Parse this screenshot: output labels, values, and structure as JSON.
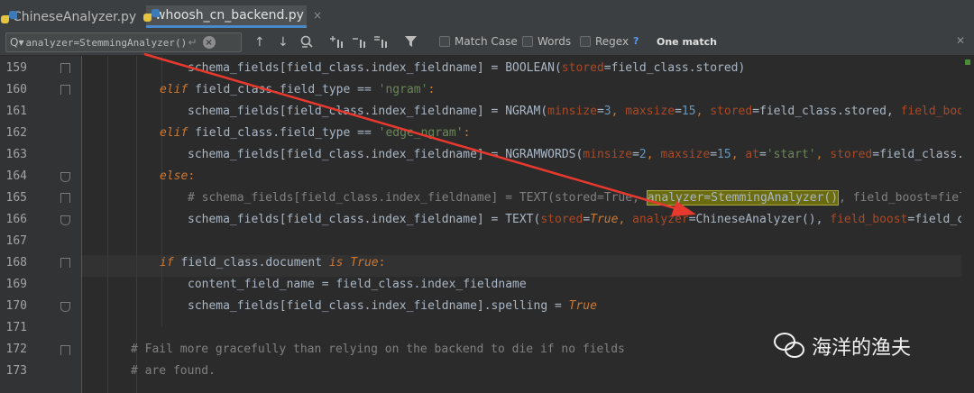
{
  "tabs": [
    {
      "label": "ChineseAnalyzer.py",
      "close": "×",
      "active": false
    },
    {
      "label": "whoosh_cn_backend.py",
      "close": "×",
      "active": true
    }
  ],
  "find": {
    "search_icon": "search-icon",
    "query": "analyzer=StemmingAnalyzer()",
    "return_glyph": "↵",
    "clear_glyph": "×",
    "prev_glyph": "↑",
    "next_glyph": "↓",
    "match_case": "Match Case",
    "words": "Words",
    "regex": "Regex",
    "help": "?",
    "status": "One match",
    "close_glyph": "✕"
  },
  "line_numbers": [
    "159",
    "160",
    "161",
    "162",
    "163",
    "164",
    "165",
    "166",
    "167",
    "168",
    "169",
    "170",
    "171",
    "172",
    "173"
  ],
  "watermark": {
    "text": "海洋的渔夫"
  },
  "colors": {
    "keyword": "#cc7832",
    "string": "#6a8759",
    "number": "#6897bb",
    "comment": "#808080",
    "param": "#aa4926",
    "highlight": "#6b6b10",
    "arrow": "#e8392e"
  },
  "code": {
    "l159": {
      "a": "schema_fields[field_class.index_fieldname] = BOOLEAN(",
      "b": "stored",
      "c": "=field_class.stored)"
    },
    "l160": {
      "a": "elif",
      "b": " field_class.field_type == ",
      "c": "'ngram'",
      "d": ":"
    },
    "l161": {
      "a": "schema_fields[field_class.index_fieldname] = NGRAM(",
      "b": "minsize",
      "c": "=",
      "d": "3",
      "e": ", ",
      "f": "maxsize",
      "g": "=",
      "h": "15",
      "i": ", ",
      "j": "stored",
      "k": "=field_class.stored, ",
      "l": "field_boost"
    },
    "l162": {
      "a": "elif",
      "b": " field_class.field_type == ",
      "c": "'edge_ngram'",
      "d": ":"
    },
    "l163": {
      "a": "schema_fields[field_class.index_fieldname] = NGRAMWORDS(",
      "b": "minsize",
      "c": "=",
      "d": "2",
      "e": ", ",
      "f": "maxsize",
      "g": "=",
      "h": "15",
      "i": ", ",
      "j": "at",
      "k": "=",
      "l": "'start'",
      "m": ", ",
      "n": "stored",
      "o": "=field_class.s"
    },
    "l164": {
      "a": "else",
      "b": ":"
    },
    "l165": {
      "a": "# schema_fields[field_class.index_fieldname] = TEXT(stored=True, ",
      "b": "analyzer=StemmingAnalyzer()",
      "c": ", field_boost=field_"
    },
    "l166": {
      "a": "schema_fields[field_class.index_fieldname] = TEXT(",
      "b": "stored",
      "c": "=",
      "d": "True",
      "e": ", ",
      "f": "analyzer",
      "g": "=ChineseAnalyzer(), ",
      "h": "field_boost",
      "i": "=field_cla"
    },
    "l168": {
      "a": "if",
      "b": " field_class.document ",
      "c": "is",
      "d": " ",
      "e": "True",
      "f": ":"
    },
    "l169": {
      "a": "content_field_name = field_class.index_fieldname"
    },
    "l170": {
      "a": "schema_fields[field_class.index_fieldname].spelling = ",
      "b": "True"
    },
    "l172": {
      "a": "# Fail more gracefully than relying on the backend to die if no fields"
    },
    "l173": {
      "a": "# are found."
    }
  }
}
